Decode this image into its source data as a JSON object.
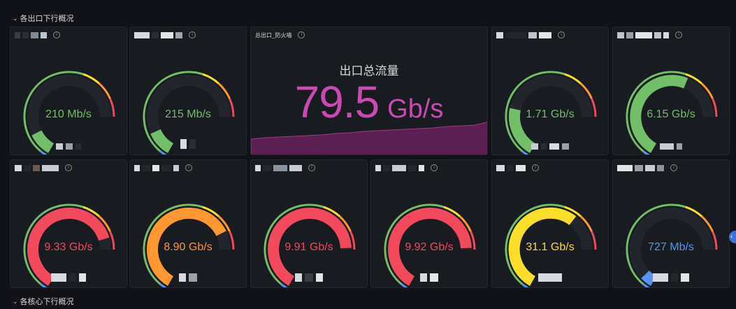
{
  "rows": [
    {
      "title": "各出口下行概况"
    },
    {
      "title": "各核心下行概况"
    }
  ],
  "colors": {
    "green": "#73bf69",
    "orange": "#ff9830",
    "red": "#f2495c",
    "yellow": "#fade2a",
    "blue": "#5794f2",
    "purple": "#c94bb1"
  },
  "stat": {
    "panel_title": "总出口_防火墙",
    "title": "出口总流量",
    "value": "79.5",
    "unit": "Gb/s"
  },
  "gauges": [
    {
      "value_text": "210 Mb/s",
      "fill": 0.14,
      "color": "#73bf69"
    },
    {
      "value_text": "215 Mb/s",
      "fill": 0.15,
      "color": "#73bf69"
    },
    {
      "value_text": "1.71 Gb/s",
      "fill": 0.3,
      "color": "#73bf69"
    },
    {
      "value_text": "6.15 Gb/s",
      "fill": 0.72,
      "color": "#73bf69"
    },
    {
      "value_text": "9.33 Gb/s",
      "fill": 0.93,
      "color": "#f2495c"
    },
    {
      "value_text": "8.90 Gb/s",
      "fill": 0.89,
      "color": "#ff9830"
    },
    {
      "value_text": "9.91 Gb/s",
      "fill": 0.99,
      "color": "#f2495c"
    },
    {
      "value_text": "9.92 Gb/s",
      "fill": 0.99,
      "color": "#f2495c"
    },
    {
      "value_text": "31.1 Gb/s",
      "fill": 0.78,
      "color": "#fade2a"
    },
    {
      "value_text": "727 Mb/s",
      "fill": 0.07,
      "color": "#5794f2"
    }
  ]
}
